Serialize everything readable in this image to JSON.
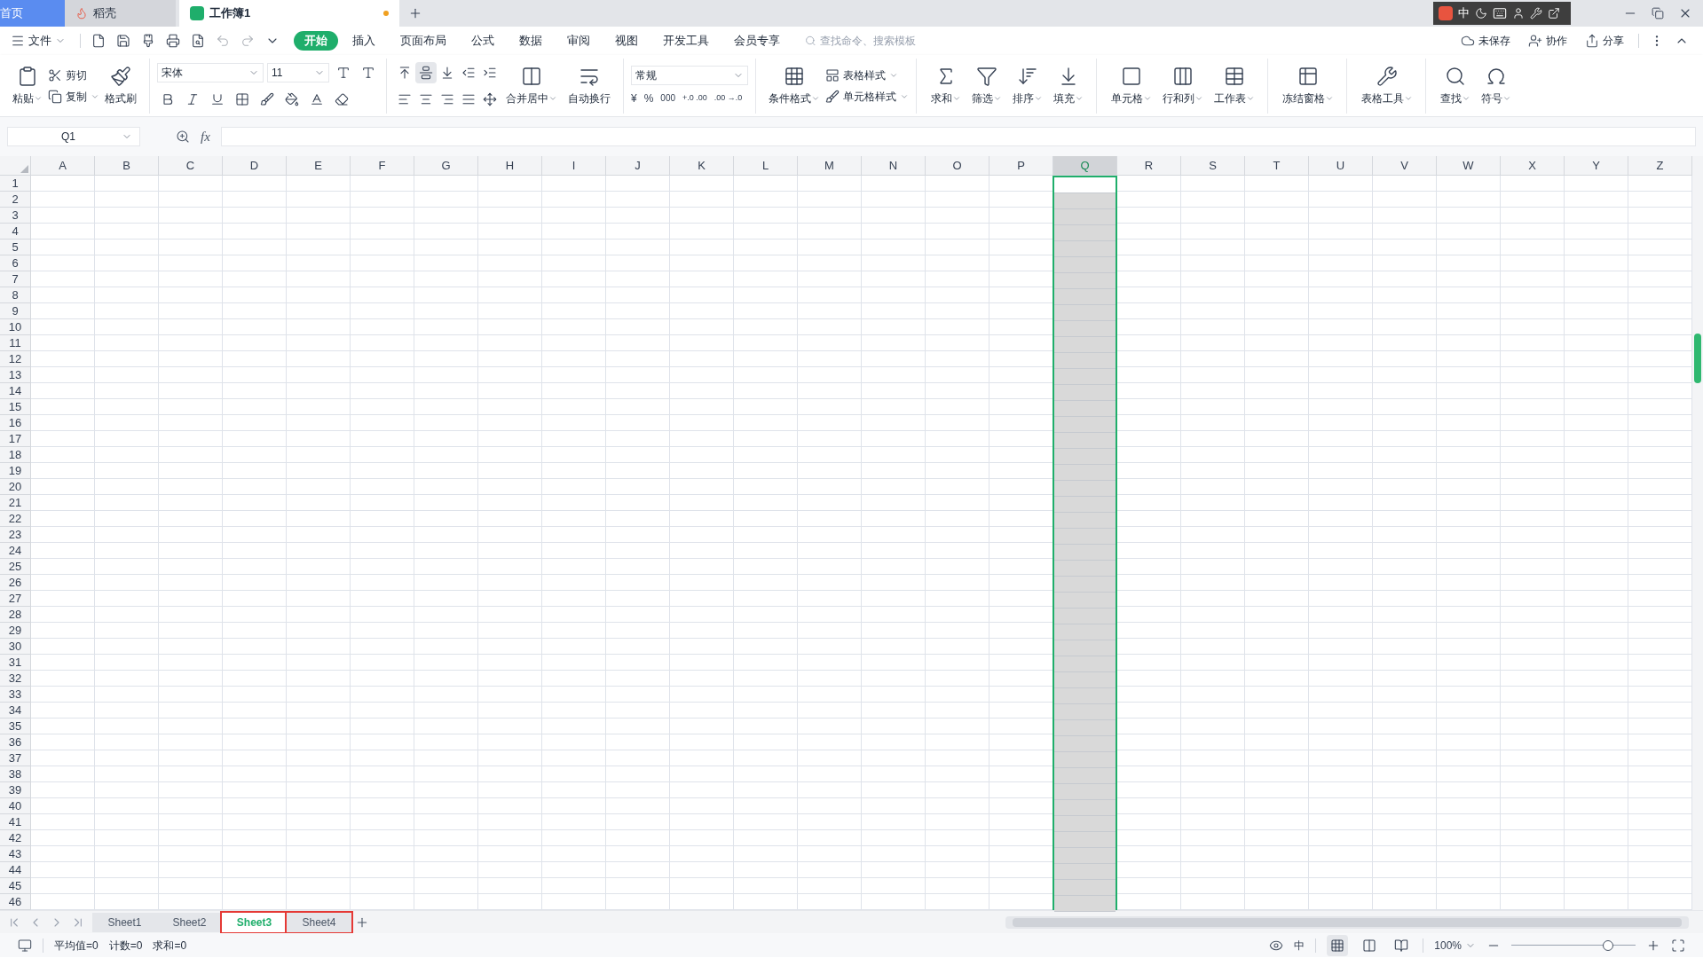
{
  "title_tabs": [
    {
      "label": "首页",
      "kind": "home",
      "selected": false
    },
    {
      "label": "稻壳",
      "kind": "docer",
      "selected": false
    },
    {
      "label": "工作簿1",
      "kind": "workbook",
      "selected": true,
      "unsaved": true
    }
  ],
  "ime_toolbar": {
    "mode": "中"
  },
  "file_menu": {
    "label": "文件"
  },
  "ribbon_tabs": [
    {
      "label": "开始",
      "selected": true
    },
    {
      "label": "插入",
      "selected": false
    },
    {
      "label": "页面布局",
      "selected": false
    },
    {
      "label": "公式",
      "selected": false
    },
    {
      "label": "数据",
      "selected": false
    },
    {
      "label": "审阅",
      "selected": false
    },
    {
      "label": "视图",
      "selected": false
    },
    {
      "label": "开发工具",
      "selected": false
    },
    {
      "label": "会员专享",
      "selected": false
    }
  ],
  "command_search": {
    "placeholder": "查找命令、搜索模板"
  },
  "right_actions": [
    "未保存",
    "协作",
    "分享"
  ],
  "ribbon": {
    "paste": "粘贴",
    "cut": "剪切",
    "copy": "复制",
    "format_painter": "格式刷",
    "font_name": "宋体",
    "font_size": "11",
    "merge": "合并居中",
    "wrap": "自动换行",
    "number_format": "常规",
    "currency": "¥",
    "percent": "%",
    "thousands": "000",
    "add_decimal": "+.0 .00",
    "remove_decimal": ".00 →.0",
    "conditional_format": "条件格式",
    "table_style": "表格样式",
    "cell_style": "单元格样式",
    "big_buttons": [
      {
        "label": "求和",
        "divider_before": true
      },
      {
        "label": "筛选",
        "divider_before": false
      },
      {
        "label": "排序",
        "divider_before": false
      },
      {
        "label": "填充",
        "divider_before": false
      },
      {
        "label": "单元格",
        "divider_before": true
      },
      {
        "label": "行和列",
        "divider_before": false
      },
      {
        "label": "工作表",
        "divider_before": false
      },
      {
        "label": "冻结窗格",
        "divider_before": true
      },
      {
        "label": "表格工具",
        "divider_before": true
      },
      {
        "label": "查找",
        "divider_before": true
      },
      {
        "label": "符号",
        "divider_before": false
      }
    ]
  },
  "formula_bar": {
    "name_box": "Q1",
    "function_label": "fx"
  },
  "columns": [
    {
      "label": "A",
      "selected": false
    },
    {
      "label": "B",
      "selected": false
    },
    {
      "label": "C",
      "selected": false
    },
    {
      "label": "D",
      "selected": false
    },
    {
      "label": "E",
      "selected": false
    },
    {
      "label": "F",
      "selected": false
    },
    {
      "label": "G",
      "selected": false
    },
    {
      "label": "H",
      "selected": false
    },
    {
      "label": "I",
      "selected": false
    },
    {
      "label": "J",
      "selected": false
    },
    {
      "label": "K",
      "selected": false
    },
    {
      "label": "L",
      "selected": false
    },
    {
      "label": "M",
      "selected": false
    },
    {
      "label": "N",
      "selected": false
    },
    {
      "label": "O",
      "selected": false
    },
    {
      "label": "P",
      "selected": false
    },
    {
      "label": "Q",
      "selected": true
    },
    {
      "label": "R",
      "selected": false
    },
    {
      "label": "S",
      "selected": false
    },
    {
      "label": "T",
      "selected": false
    },
    {
      "label": "U",
      "selected": false
    },
    {
      "label": "V",
      "selected": false
    },
    {
      "label": "W",
      "selected": false
    },
    {
      "label": "X",
      "selected": false
    },
    {
      "label": "Y",
      "selected": false
    },
    {
      "label": "Z",
      "selected": false
    }
  ],
  "rows": [
    {
      "label": "1",
      "active": true
    },
    {
      "label": "2",
      "active": false
    },
    {
      "label": "3",
      "active": false
    },
    {
      "label": "4",
      "active": false
    },
    {
      "label": "5",
      "active": false
    },
    {
      "label": "6",
      "active": false
    },
    {
      "label": "7",
      "active": false
    },
    {
      "label": "8",
      "active": false
    },
    {
      "label": "9",
      "active": false
    },
    {
      "label": "10",
      "active": false
    },
    {
      "label": "11",
      "active": false
    },
    {
      "label": "12",
      "active": false
    },
    {
      "label": "13",
      "active": false
    },
    {
      "label": "14",
      "active": false
    },
    {
      "label": "15",
      "active": false
    },
    {
      "label": "16",
      "active": false
    },
    {
      "label": "17",
      "active": false
    },
    {
      "label": "18",
      "active": false
    },
    {
      "label": "19",
      "active": false
    },
    {
      "label": "20",
      "active": false
    },
    {
      "label": "21",
      "active": false
    },
    {
      "label": "22",
      "active": false
    },
    {
      "label": "23",
      "active": false
    },
    {
      "label": "24",
      "active": false
    },
    {
      "label": "25",
      "active": false
    },
    {
      "label": "26",
      "active": false
    },
    {
      "label": "27",
      "active": false
    },
    {
      "label": "28",
      "active": false
    },
    {
      "label": "29",
      "active": false
    },
    {
      "label": "30",
      "active": false
    },
    {
      "label": "31",
      "active": false
    },
    {
      "label": "32",
      "active": false
    },
    {
      "label": "33",
      "active": false
    },
    {
      "label": "34",
      "active": false
    },
    {
      "label": "35",
      "active": false
    },
    {
      "label": "36",
      "active": false
    },
    {
      "label": "37",
      "active": false
    },
    {
      "label": "38",
      "active": false
    },
    {
      "label": "39",
      "active": false
    },
    {
      "label": "40",
      "active": false
    },
    {
      "label": "41",
      "active": false
    },
    {
      "label": "42",
      "active": false
    },
    {
      "label": "43",
      "active": false
    },
    {
      "label": "44",
      "active": false
    },
    {
      "label": "45",
      "active": false
    },
    {
      "label": "46",
      "active": false
    }
  ],
  "sheets": [
    {
      "label": "Sheet1",
      "selected": false,
      "highlighted": false
    },
    {
      "label": "Sheet2",
      "selected": false,
      "highlighted": false
    },
    {
      "label": "Sheet3",
      "selected": true,
      "highlighted": true
    },
    {
      "label": "Sheet4",
      "selected": false,
      "highlighted": true
    }
  ],
  "status_bar": {
    "stats": [
      "平均值=0",
      "计数=0",
      "求和=0"
    ],
    "input_mode": "中",
    "views": [
      {
        "selected": true
      },
      {
        "selected": false
      },
      {
        "selected": false
      }
    ],
    "zoom": {
      "reading": "100%",
      "level": 0.78
    }
  }
}
